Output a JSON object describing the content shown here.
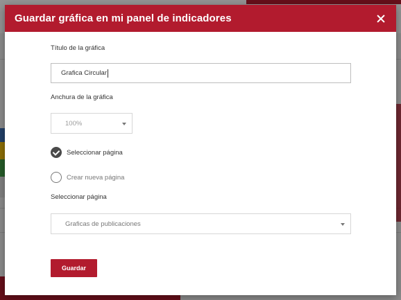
{
  "modal": {
    "title": "Guardar gráfica en mi panel de indicadores",
    "close_label": "×"
  },
  "form": {
    "chart_title_label": "Título de la gráfica",
    "chart_title_value": "Grafica Circular",
    "chart_width_label": "Anchura de la gráfica",
    "chart_width_value": "100%",
    "option_select_page": "Seleccionar página",
    "option_new_page": "Crear nueva página",
    "select_page_label": "Seleccionar página",
    "select_page_value": "Graficas de publicaciones",
    "save_label": "Guardar",
    "selected_option": "select_page"
  },
  "colors": {
    "accent": "#b21b2e",
    "overlay": "rgba(0,0,0,0.42)"
  }
}
